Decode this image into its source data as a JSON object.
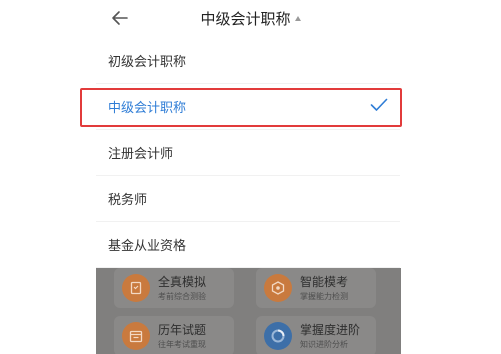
{
  "header": {
    "title": "中级会计职称",
    "back_icon": "arrow-left-icon",
    "caret_icon": "caret-up-icon"
  },
  "options": [
    {
      "label": "初级会计职称",
      "selected": false
    },
    {
      "label": "中级会计职称",
      "selected": true
    },
    {
      "label": "注册会计师",
      "selected": false
    },
    {
      "label": "税务师",
      "selected": false
    },
    {
      "label": "基金从业资格",
      "selected": false
    }
  ],
  "background_cards": [
    {
      "title": "全真模拟",
      "subtitle": "考前综合测验",
      "icon": "document-icon"
    },
    {
      "title": "智能模考",
      "subtitle": "掌握能力检测",
      "icon": "hexagon-icon"
    },
    {
      "title": "历年试题",
      "subtitle": "往年考试重现",
      "icon": "calendar-icon"
    },
    {
      "title": "掌握度进阶",
      "subtitle": "知识进阶分析",
      "icon": "progress-ring-icon"
    }
  ],
  "colors": {
    "selected_text": "#2f7dd6",
    "highlight_border": "#e23b3b",
    "overlay": "#807f7e"
  }
}
